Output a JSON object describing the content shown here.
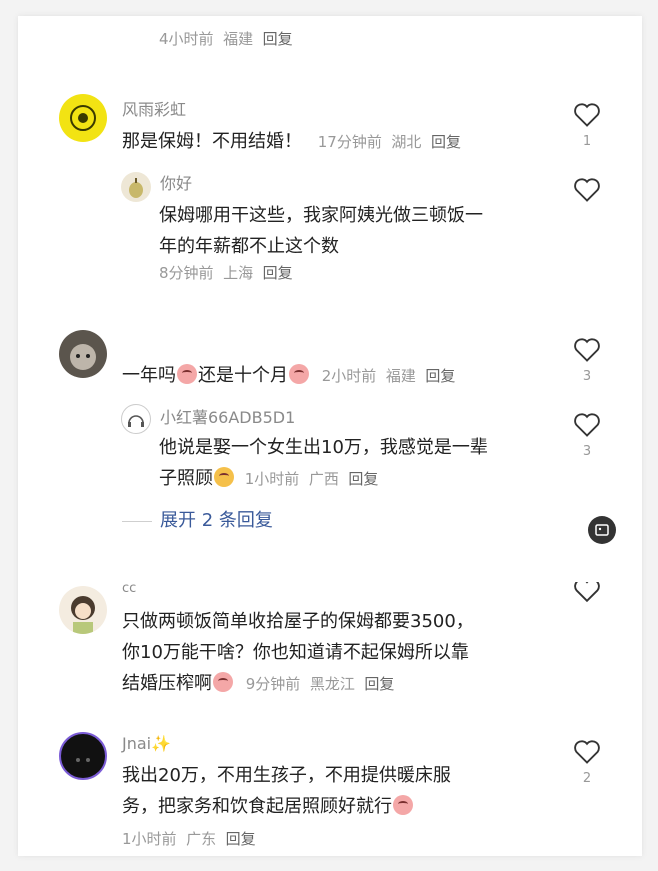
{
  "top_meta": {
    "time": "4小时前",
    "loc": "福建",
    "reply": "回复"
  },
  "comments": [
    {
      "user": "风雨彩虹",
      "text": "那是保姆！不用结婚！",
      "time": "17分钟前",
      "loc": "湖北",
      "reply": "回复",
      "likes": "1",
      "reply_item": {
        "user": "你好",
        "line1": "保姆哪用干这些，我家阿姨光做三顿饭一",
        "line2": "年的年薪都不止这个数",
        "time": "8分钟前",
        "loc": "上海",
        "reply": "回复",
        "likes": ""
      }
    },
    {
      "user": "",
      "text_a": "一年吗",
      "text_b": "还是十个月",
      "time": "2小时前",
      "loc": "福建",
      "reply": "回复",
      "likes": "3",
      "reply_item": {
        "user": "小红薯66ADB5D1",
        "line1": "他说是娶一个女生出10万，我感觉是一辈",
        "line2": "子照顾",
        "time": "1小时前",
        "loc": "广西",
        "reply": "回复",
        "likes": "3"
      },
      "expand": "展开 2 条回复"
    },
    {
      "user": "cc",
      "line1": "只做两顿饭简单收拾屋子的保姆都要3500，",
      "line2": "你10万能干啥？你也知道请不起保姆所以靠",
      "line3": "结婚压榨啊",
      "time": "9分钟前",
      "loc": "黑龙江",
      "reply": "回复"
    },
    {
      "user": "Jnai✨",
      "line1": "我出20万，不用生孩子，不用提供暖床服",
      "line2": "务，把家务和饮食起居照顾好就行",
      "time": "1小时前",
      "loc": "广东",
      "reply": "回复",
      "likes": "2"
    }
  ],
  "colors": {
    "accent": "#3a5a9a",
    "text": "#222222",
    "meta": "#999999"
  }
}
